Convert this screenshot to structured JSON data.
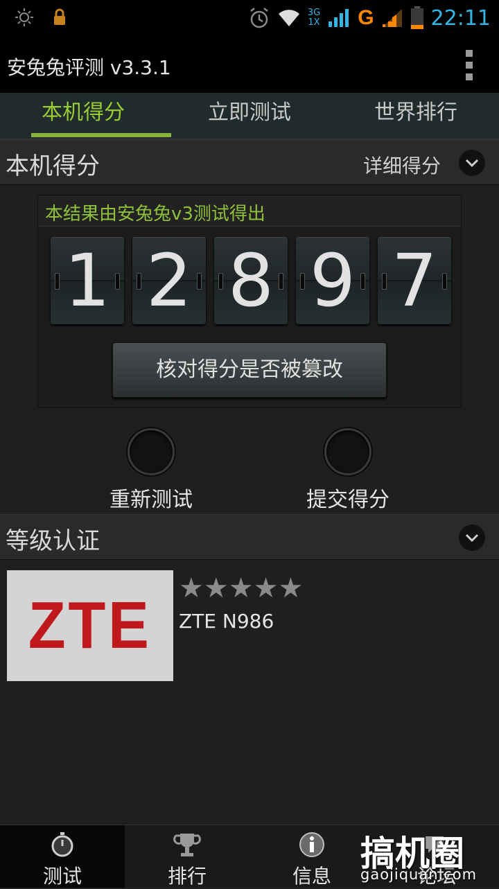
{
  "status_bar": {
    "time": "22:11",
    "network_3g": "3G",
    "network_1x": "1X",
    "network_g": "G",
    "icons": [
      "brightness-icon",
      "lock-icon",
      "alarm-icon",
      "wifi-icon",
      "signal-icon",
      "battery-icon"
    ]
  },
  "app": {
    "title": "安兔兔评测 v3.3.1"
  },
  "tabs": [
    {
      "label": "本机得分",
      "active": true
    },
    {
      "label": "立即测试",
      "active": false
    },
    {
      "label": "世界排行",
      "active": false
    }
  ],
  "score_section": {
    "title": "本机得分",
    "detail_label": "详细得分",
    "caption": "本结果由安兔兔v3测试得出",
    "digits": [
      "1",
      "2",
      "8",
      "9",
      "7"
    ],
    "verify_button": "核对得分是否被篡改"
  },
  "actions": {
    "retest": "重新测试",
    "submit": "提交得分"
  },
  "cert_section": {
    "title": "等级认证",
    "logo_text": "ZTE",
    "stars": "★★★★★",
    "rating_stars": 5,
    "model": "ZTE N986"
  },
  "bottom_nav": [
    {
      "label": "测试",
      "icon": "stopwatch-icon",
      "active": true
    },
    {
      "label": "排行",
      "icon": "trophy-icon",
      "active": false
    },
    {
      "label": "信息",
      "icon": "info-icon",
      "active": false
    },
    {
      "label": "论坛",
      "icon": "forum-icon",
      "active": false
    }
  ],
  "watermark": {
    "logo": "搞机圈",
    "url": "gaojiquan.com"
  },
  "colors": {
    "accent_green": "#99cc33",
    "holo_blue": "#33b5e5",
    "zte_red": "#c0191d"
  }
}
